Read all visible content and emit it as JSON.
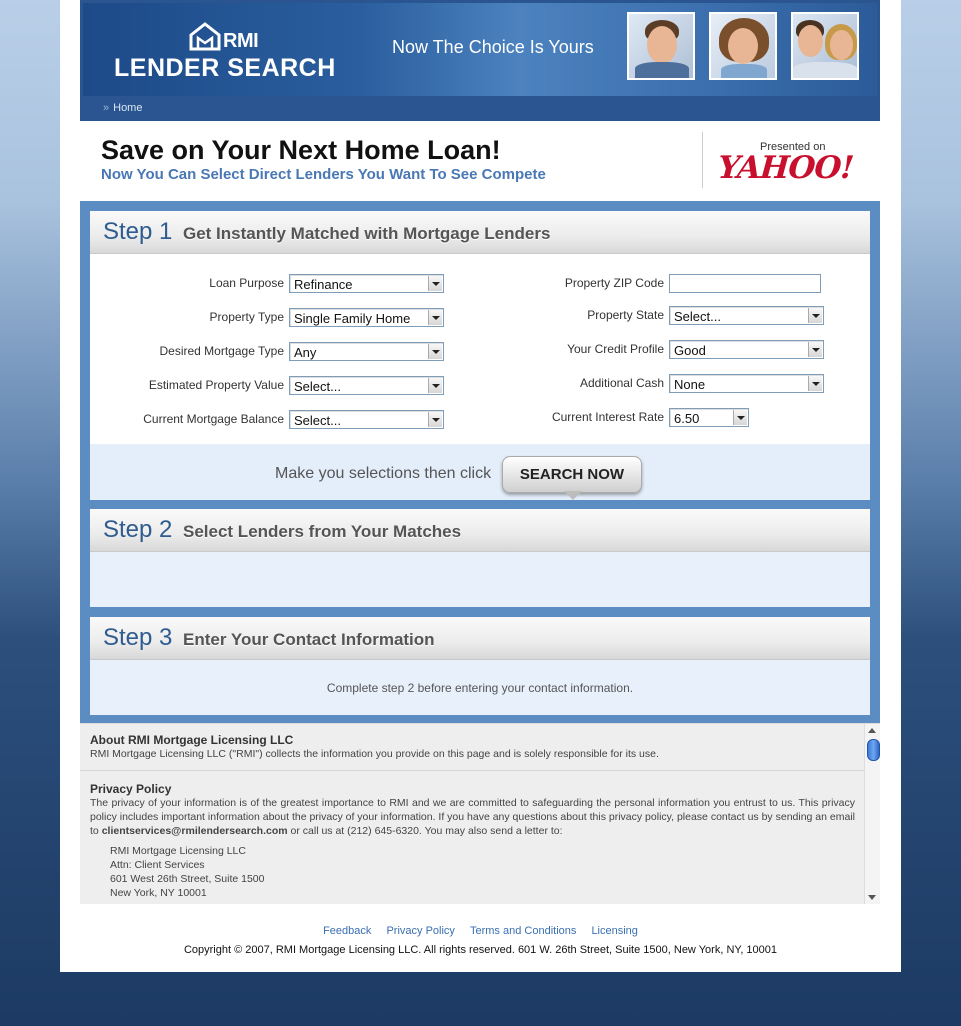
{
  "header": {
    "logo_small": "RMI",
    "logo_main": "LENDER SEARCH",
    "tagline": "Now The Choice Is Yours",
    "breadcrumb_sep": "»",
    "breadcrumb_home": "Home"
  },
  "hero": {
    "title": "Save on Your Next Home Loan!",
    "subtitle": "Now You Can Select Direct Lenders You Want To See Compete",
    "presented_on": "Presented on",
    "partner": "YAHOO!"
  },
  "step1": {
    "num": "Step 1",
    "title": "Get Instantly Matched with Mortgage Lenders",
    "left_fields": [
      {
        "label": "Loan Purpose",
        "value": "Refinance"
      },
      {
        "label": "Property Type",
        "value": "Single Family Home"
      },
      {
        "label": "Desired Mortgage Type",
        "value": "Any"
      },
      {
        "label": "Estimated Property Value",
        "value": "Select..."
      },
      {
        "label": "Current Mortgage Balance",
        "value": "Select..."
      }
    ],
    "right_fields": [
      {
        "label": "Property ZIP Code",
        "value": ""
      },
      {
        "label": "Property State",
        "value": "Select..."
      },
      {
        "label": "Your Credit Profile",
        "value": "Good"
      },
      {
        "label": "Additional Cash",
        "value": "None"
      },
      {
        "label": "Current Interest Rate",
        "value": "6.50"
      }
    ],
    "search_hint": "Make you selections then click",
    "search_button": "SEARCH NOW"
  },
  "step2": {
    "num": "Step 2",
    "title": "Select Lenders from Your Matches"
  },
  "step3": {
    "num": "Step 3",
    "title": "Enter Your Contact Information",
    "message": "Complete step 2 before entering your contact information."
  },
  "info": {
    "about_title": "About RMI Mortgage Licensing LLC",
    "about_text": "RMI Mortgage Licensing LLC (\"RMI\") collects the information you provide on this page and is solely responsible for its use.",
    "privacy_title": "Privacy Policy",
    "privacy_text_1": "The privacy of your information is of the greatest importance to RMI and we are committed to safeguarding the personal information you entrust to us. This privacy policy includes important information about the privacy of your information. If you have any questions about this privacy policy, please contact us by sending an email to ",
    "privacy_email": "clientservices@rmilendersearch.com",
    "privacy_text_2": " or call us at (212) 645-6320. You may also send a letter to:",
    "address": [
      "RMI Mortgage Licensing LLC",
      "Attn: Client Services",
      "601 West 26th Street, Suite 1500",
      "New York, NY 10001"
    ]
  },
  "footer": {
    "links": [
      "Feedback",
      "Privacy Policy",
      "Terms and Conditions",
      "Licensing"
    ],
    "copyright": "Copyright © 2007, RMI Mortgage Licensing LLC. All rights reserved. 601 W. 26th Street, Suite 1500, New York, NY, 10001"
  },
  "colors": {
    "brand_blue": "#2a5590",
    "accent_blue": "#4a78b5",
    "yahoo_red": "#c8102e",
    "frame_blue": "#5b8dc2"
  }
}
